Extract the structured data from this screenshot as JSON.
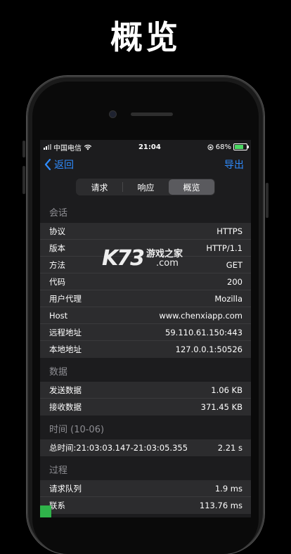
{
  "banner": {
    "title": "概览"
  },
  "status": {
    "carrier": "中国电信",
    "time": "21:04",
    "battery": "68%",
    "battery_level": 0.68
  },
  "nav": {
    "back_label": "返回",
    "export_label": "导出"
  },
  "tabs": [
    {
      "label": "请求",
      "active": false
    },
    {
      "label": "响应",
      "active": false
    },
    {
      "label": "概览",
      "active": true
    }
  ],
  "sections": {
    "session": {
      "title": "会话",
      "rows": [
        {
          "key": "协议",
          "value": "HTTPS"
        },
        {
          "key": "版本",
          "value": "HTTP/1.1"
        },
        {
          "key": "方法",
          "value": "GET"
        },
        {
          "key": "代码",
          "value": "200"
        },
        {
          "key": "用户代理",
          "value": "Mozilla"
        },
        {
          "key": "Host",
          "value": "www.chenxiapp.com"
        },
        {
          "key": "远程地址",
          "value": "59.110.61.150:443"
        },
        {
          "key": "本地地址",
          "value": "127.0.0.1:50526"
        }
      ]
    },
    "data": {
      "title": "数据",
      "rows": [
        {
          "key": "发送数据",
          "value": "1.06 KB"
        },
        {
          "key": "接收数据",
          "value": "371.45 KB"
        }
      ]
    },
    "time": {
      "title": "时间 (10-06)",
      "rows": [
        {
          "key": "总时间:21:03:03.147-21:03:05.355",
          "value": "2.21 s"
        }
      ]
    },
    "process": {
      "title": "过程",
      "rows": [
        {
          "key": "请求队列",
          "value": "1.9 ms"
        },
        {
          "key": "联系",
          "value": "113.76 ms"
        }
      ]
    }
  },
  "watermark": {
    "logo": "K73",
    "cn": "游戏之家",
    "domain": ".com"
  },
  "colors": {
    "accent": "#2f8cff",
    "background": "#1c1c1e",
    "cell": "#2c2c2e",
    "section_header": "#8e8e93"
  }
}
